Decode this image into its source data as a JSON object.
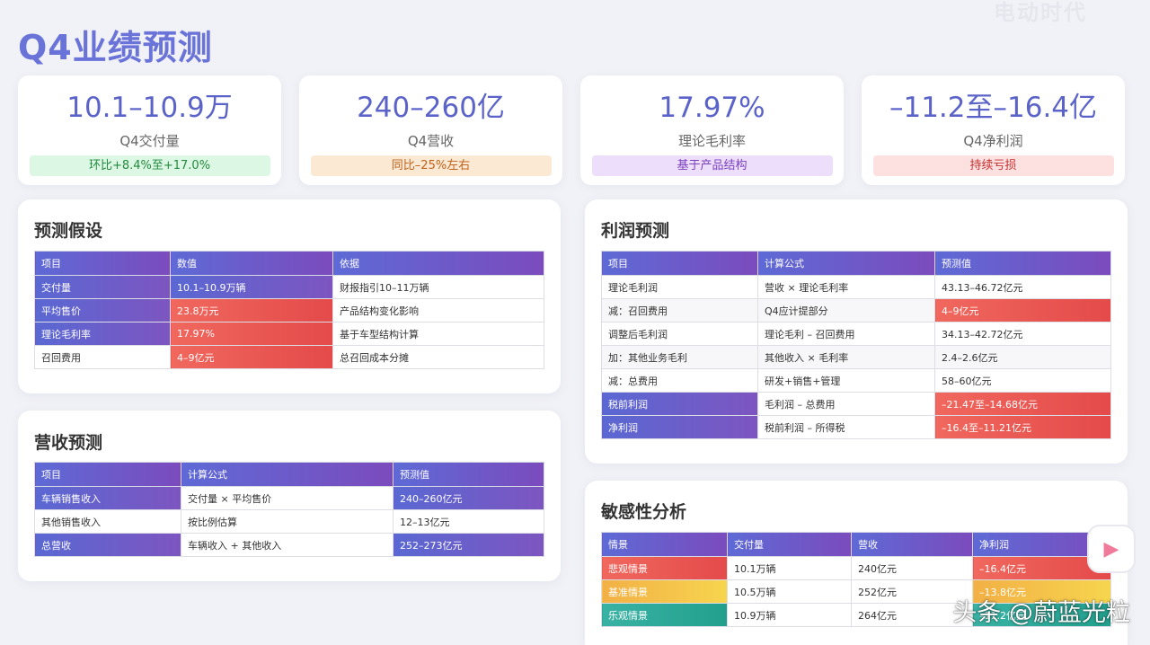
{
  "page_title": "Q4业绩预测",
  "top_watermark": "电动时代",
  "kpis": [
    {
      "value": "10.1–10.9万",
      "label": "Q4交付量",
      "tag": "环比+8.4%至+17.0%"
    },
    {
      "value": "240–260亿",
      "label": "Q4营收",
      "tag": "同比–25%左右"
    },
    {
      "value": "17.97%",
      "label": "理论毛利率",
      "tag": "基于产品结构"
    },
    {
      "value": "–11.2至–16.4亿",
      "label": "Q4净利润",
      "tag": "持续亏损"
    }
  ],
  "assumptions": {
    "title": "预测假设",
    "headers": [
      "项目",
      "数值",
      "依据"
    ],
    "rows": [
      [
        "交付量",
        "10.1–10.9万辆",
        "财报指引10–11万辆"
      ],
      [
        "平均售价",
        "23.8万元",
        "产品结构变化影响"
      ],
      [
        "理论毛利率",
        "17.97%",
        "基于车型结构计算"
      ],
      [
        "召回费用",
        "4–9亿元",
        "总召回成本分摊"
      ]
    ]
  },
  "revenue": {
    "title": "营收预测",
    "headers": [
      "项目",
      "计算公式",
      "预测值"
    ],
    "rows": [
      [
        "车辆销售收入",
        "交付量 × 平均售价",
        "240–260亿元"
      ],
      [
        "其他销售收入",
        "按比例估算",
        "12–13亿元"
      ],
      [
        "总营收",
        "车辆收入 + 其他收入",
        "252–273亿元"
      ]
    ]
  },
  "profit": {
    "title": "利润预测",
    "headers": [
      "项目",
      "计算公式",
      "预测值"
    ],
    "rows": [
      [
        "理论毛利润",
        "营收 × 理论毛利率",
        "43.13–46.72亿元"
      ],
      [
        "减：召回费用",
        "Q4应计提部分",
        "4–9亿元"
      ],
      [
        "调整后毛利润",
        "理论毛利 – 召回费用",
        "34.13–42.72亿元"
      ],
      [
        "加：其他业务毛利",
        "其他收入 × 毛利率",
        "2.4–2.6亿元"
      ],
      [
        "减：总费用",
        "研发+销售+管理",
        "58–60亿元"
      ],
      [
        "税前利润",
        "毛利润 – 总费用",
        "–21.47至–14.68亿元"
      ],
      [
        "净利润",
        "税前利润 – 所得税",
        "–16.4至–11.21亿元"
      ]
    ]
  },
  "sensitivity": {
    "title": "敏感性分析",
    "headers": [
      "情景",
      "交付量",
      "营收",
      "净利润"
    ],
    "rows": [
      [
        "悲观情景",
        "10.1万辆",
        "240亿元",
        "–16.4亿元"
      ],
      [
        "基准情景",
        "10.5万辆",
        "252亿元",
        "–13.8亿元"
      ],
      [
        "乐观情景",
        "10.9万辆",
        "264亿元",
        "–11.2亿元"
      ]
    ]
  },
  "bottom_watermark": "头条 @蔚蓝光粒",
  "side_icon": "play-icon"
}
